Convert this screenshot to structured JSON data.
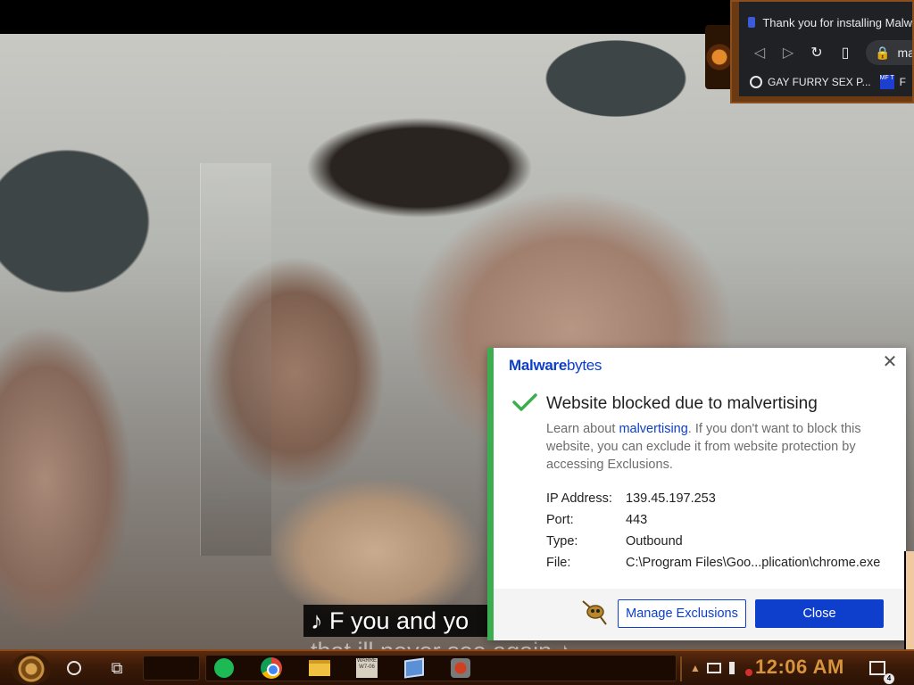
{
  "caption": {
    "line1": "♪ F you and  yo",
    "line2": "that ill never see again ♪"
  },
  "browser": {
    "tab_title": "Thank you for installing Malw",
    "omnibox_text": "malw",
    "bookmarks": [
      {
        "label": "GAY FURRY SEX P...",
        "icon": "globe-icon"
      },
      {
        "label": "F",
        "icon": "mft-icon"
      }
    ],
    "mft_badge": "MF T"
  },
  "malwarebytes": {
    "logo_bold": "Malware",
    "logo_light": "bytes",
    "title": "Website blocked due to malvertising",
    "desc_prefix": "Learn about ",
    "desc_link": "malvertising",
    "desc_suffix": ". If you don't want to block this website, you can exclude it from website protection by accessing Exclusions.",
    "details": [
      {
        "key": "IP Address:",
        "value": "139.45.197.253"
      },
      {
        "key": "Port:",
        "value": "443"
      },
      {
        "key": "Type:",
        "value": "Outbound"
      },
      {
        "key": "File:",
        "value": "C:\\Program Files\\Goo...plication\\chrome.exe"
      }
    ],
    "manage_label": "Manage Exclusions",
    "close_label": "Close",
    "accent_color": "#3cae4f",
    "brand_color": "#0d3ecc"
  },
  "taskbar": {
    "clock": "12:06 AM",
    "notification_count": "4",
    "winword_label": "WARRE\nW7-06"
  }
}
